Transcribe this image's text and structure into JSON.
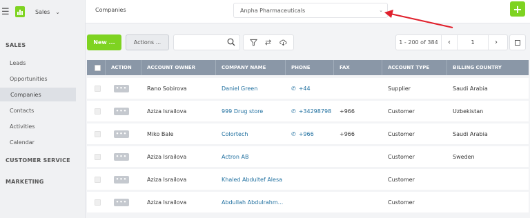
{
  "app": {
    "name": "Sales"
  },
  "sidebar": {
    "sections": [
      {
        "label": "SALES"
      },
      {
        "label": "CUSTOMER SERVICE"
      },
      {
        "label": "MARKETING"
      }
    ],
    "items": [
      {
        "label": "Leads"
      },
      {
        "label": "Opportunities"
      },
      {
        "label": "Companies"
      },
      {
        "label": "Contacts"
      },
      {
        "label": "Activities"
      },
      {
        "label": "Calendar"
      }
    ]
  },
  "topbar": {
    "breadcrumb": "Companies",
    "company_select": "Anpha Pharmaceuticals"
  },
  "toolbar": {
    "new_label": "New ...",
    "actions_label": "Actions ...",
    "search_placeholder": ""
  },
  "pagination": {
    "range": "1 - 200 of 384",
    "page": "1"
  },
  "table": {
    "columns": [
      "ACTION",
      "ACCOUNT OWNER",
      "COMPANY NAME",
      "PHONE",
      "FAX",
      "ACCOUNT TYPE",
      "BILLING COUNTRY"
    ],
    "action_label": "•••",
    "rows": [
      {
        "owner": "Rano Sobirova",
        "company": "Daniel Green",
        "phone": "+44",
        "fax": "",
        "type": "Supplier",
        "country": "Saudi Arabia"
      },
      {
        "owner": "Aziza Israilova",
        "company": "999 Drug store",
        "phone": "+34298798",
        "fax": "+966",
        "type": "Customer",
        "country": "Uzbekistan"
      },
      {
        "owner": "Miko Bale",
        "company": "Colortech",
        "phone": "+966",
        "fax": "+966",
        "type": "Customer",
        "country": "Saudi Arabia"
      },
      {
        "owner": "Aziza Israilova",
        "company": "Actron AB",
        "phone": "",
        "fax": "",
        "type": "Customer",
        "country": "Sweden"
      },
      {
        "owner": "Aziza Israilova",
        "company": "Khaled Abdultef Alesa",
        "phone": "",
        "fax": "",
        "type": "Customer",
        "country": ""
      },
      {
        "owner": "Aziza Israilova",
        "company": "Abdullah Abdulrahm...",
        "phone": "",
        "fax": "",
        "type": "Customer",
        "country": ""
      }
    ]
  },
  "colors": {
    "accent": "#7ed321",
    "header": "#8a97a7",
    "link": "#1f6f9f",
    "annotation": "#e0202c"
  }
}
